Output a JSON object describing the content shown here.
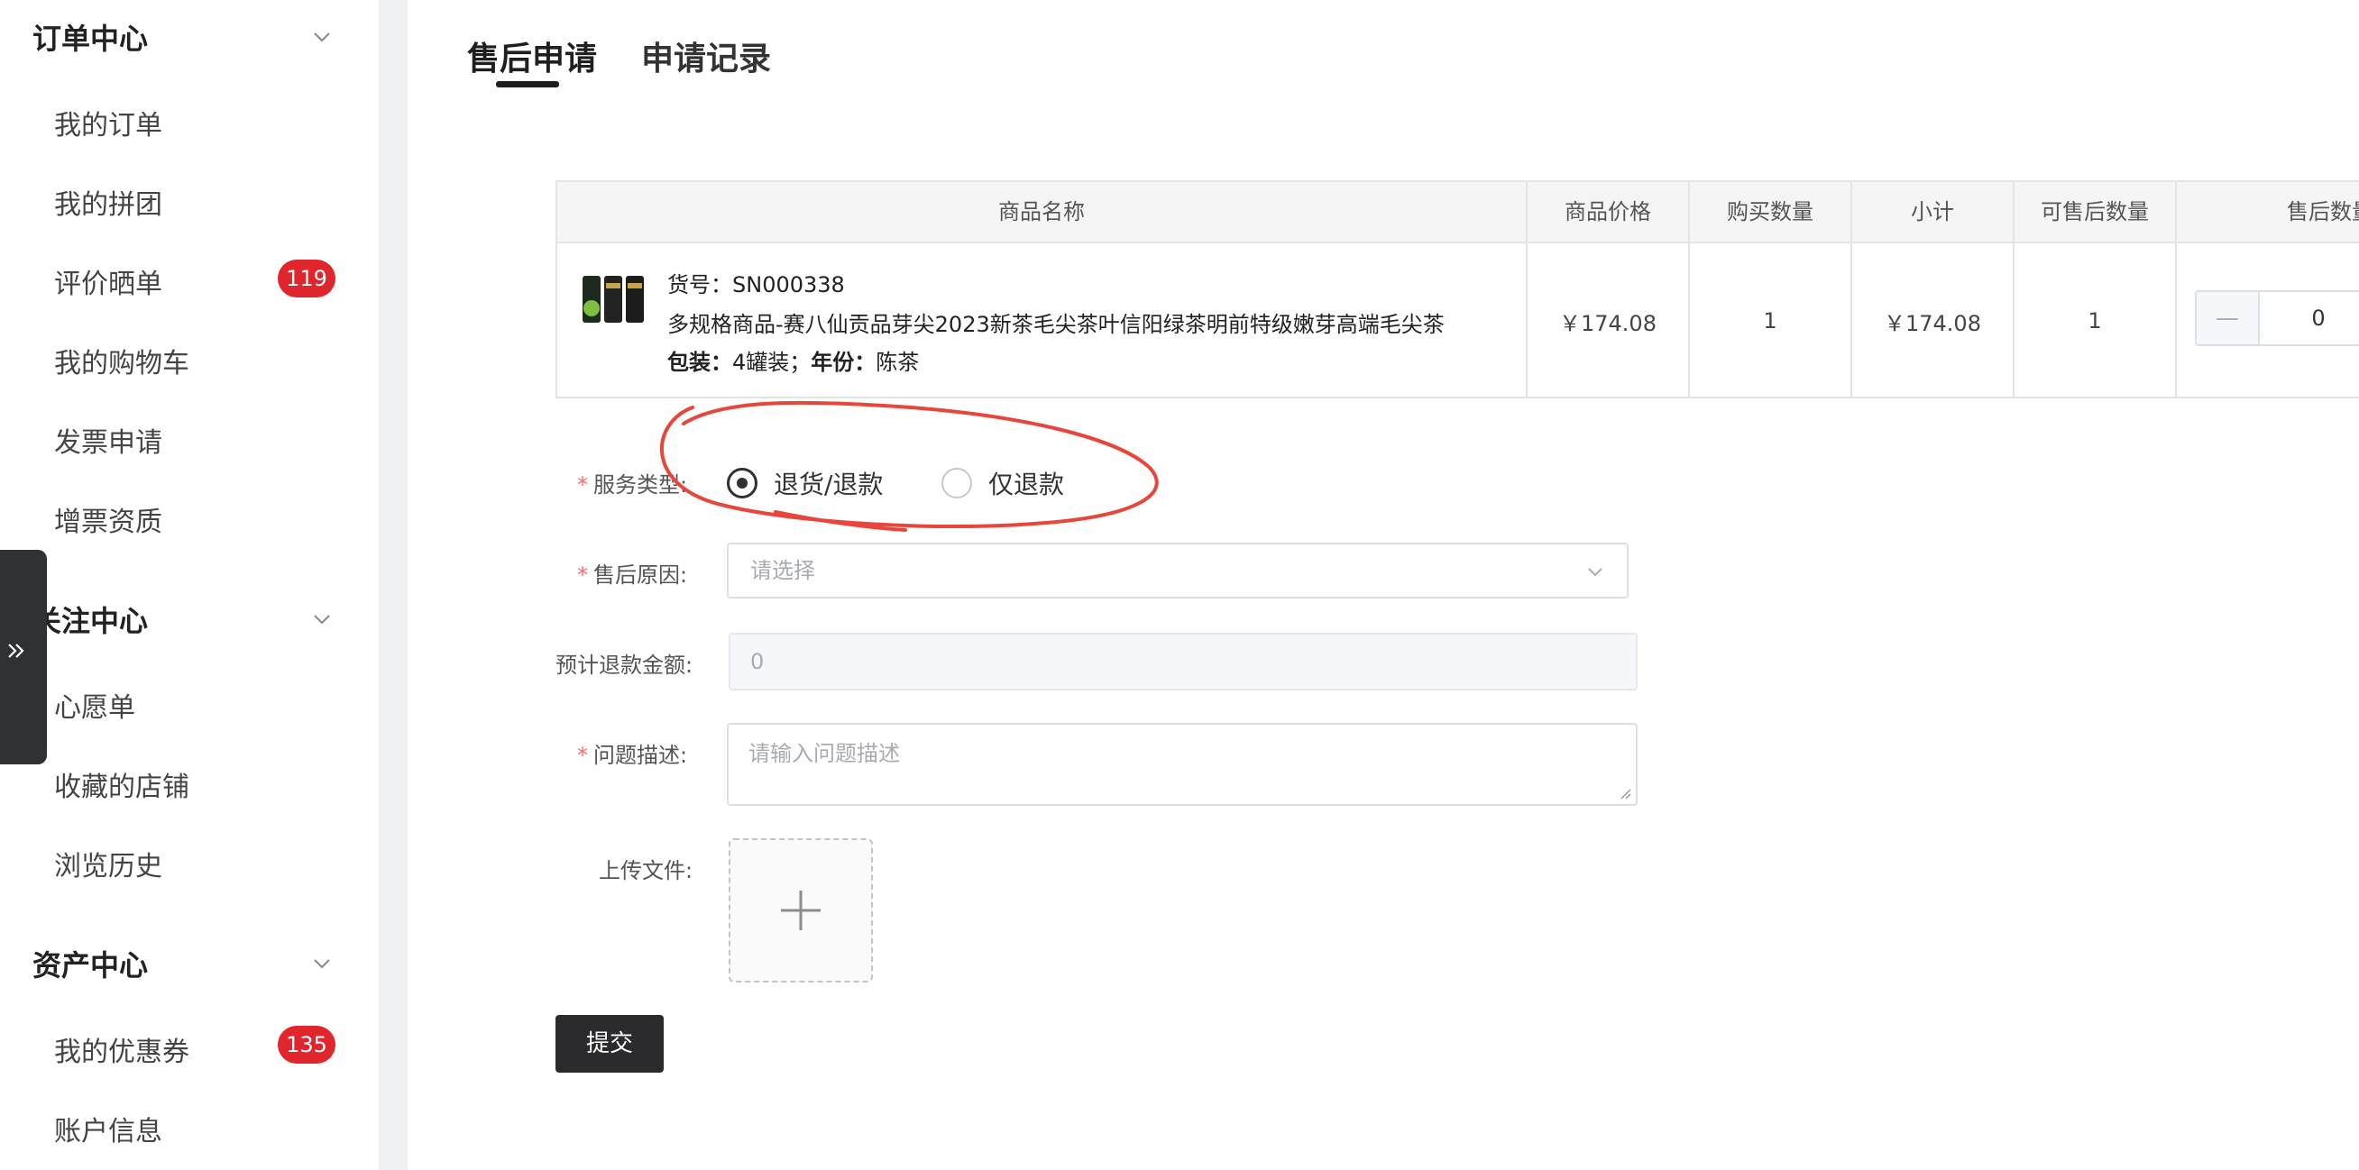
{
  "sidebar": {
    "groups": [
      {
        "title": "订单中心",
        "items": [
          {
            "label": "我的订单"
          },
          {
            "label": "我的拼团"
          },
          {
            "label": "评价晒单",
            "badge": "119"
          },
          {
            "label": "我的购物车"
          },
          {
            "label": "发票申请"
          },
          {
            "label": "增票资质"
          }
        ]
      },
      {
        "title": "关注中心",
        "items": [
          {
            "label": "心愿单"
          },
          {
            "label": "收藏的店铺"
          },
          {
            "label": "浏览历史"
          }
        ]
      },
      {
        "title": "资产中心",
        "items": [
          {
            "label": "我的优惠券",
            "badge": "135"
          },
          {
            "label": "账户信息"
          }
        ]
      }
    ]
  },
  "tabs": [
    {
      "label": "售后申请",
      "active": true
    },
    {
      "label": "申请记录",
      "active": false
    }
  ],
  "table": {
    "headers": [
      "商品名称",
      "商品价格",
      "购买数量",
      "小计",
      "可售后数量",
      "售后数量"
    ],
    "row": {
      "sku_label": "货号：",
      "sku": "SN000338",
      "name": "多规格商品-赛八仙贡品芽尖2023新茶毛尖茶叶信阳绿茶明前特级嫩芽高端毛尖茶",
      "spec1_label": "包装：",
      "spec1_value": "4罐装；",
      "spec2_label": "年份：",
      "spec2_value": "陈茶",
      "price": "￥174.08",
      "quantity": "1",
      "subtotal": "￥174.08",
      "afterSaleable": "1",
      "afterSaleQty": "0",
      "minus": "—"
    }
  },
  "form": {
    "serviceType": {
      "label": "服务类型:",
      "options": [
        {
          "label": "退货/退款",
          "checked": true
        },
        {
          "label": "仅退款",
          "checked": false
        }
      ]
    },
    "reason": {
      "label": "售后原因:",
      "placeholder": "请选择"
    },
    "refund": {
      "label": "预计退款金额:",
      "value": "0"
    },
    "description": {
      "label": "问题描述:",
      "placeholder": "请输入问题描述"
    },
    "upload": {
      "label": "上传文件:"
    },
    "required_mark": "*",
    "submit": "提交"
  },
  "colors": {
    "badge": "#e0262c",
    "annotation": "#e8463a",
    "primary": "#2b2b2e"
  }
}
